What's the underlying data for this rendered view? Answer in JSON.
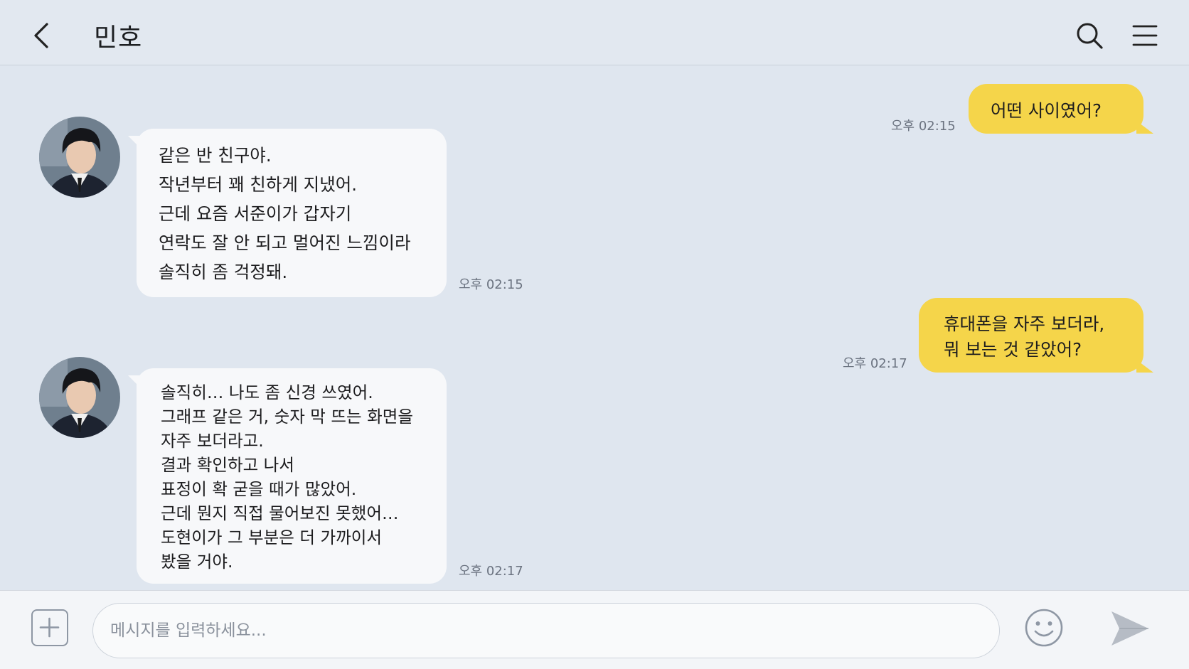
{
  "header": {
    "title": "민호",
    "back_icon": "chevron-left-icon",
    "search_icon": "search-icon",
    "menu_icon": "hamburger-menu-icon"
  },
  "messages": [
    {
      "direction": "out",
      "lines": [
        "어떤 사이였어?"
      ],
      "time": "오후 02:15"
    },
    {
      "direction": "in",
      "lines": [
        "같은 반 친구야.",
        "작년부터 꽤 친하게 지냈어.",
        "근데 요즘 서준이가 갑자기",
        "연락도 잘 안 되고 멀어진 느낌이라",
        "솔직히 좀 걱정돼."
      ],
      "time": "오후 02:15"
    },
    {
      "direction": "out",
      "lines": [
        "휴대폰을 자주 보더라,",
        "뭐 보는 것 같았어?"
      ],
      "time": "오후 02:17"
    },
    {
      "direction": "in",
      "lines": [
        "솔직히… 나도 좀 신경 쓰였어.",
        "그래프 같은 거, 숫자 막 뜨는 화면을",
        "자주 보더라고.",
        "결과 확인하고 나서",
        "표정이 확 굳을 때가 많았어.",
        "근데 뭔지 직접 물어보진 못했어…",
        "도현이가 그 부분은 더 가까이서",
        "봤을 거야."
      ],
      "time": "오후 02:17"
    }
  ],
  "input": {
    "placeholder": "메시지를 입력하세요...",
    "value": ""
  },
  "colors": {
    "background": "#dfe6ef",
    "incoming_bubble": "#f7f8fa",
    "outgoing_bubble": "#f5d54a"
  }
}
